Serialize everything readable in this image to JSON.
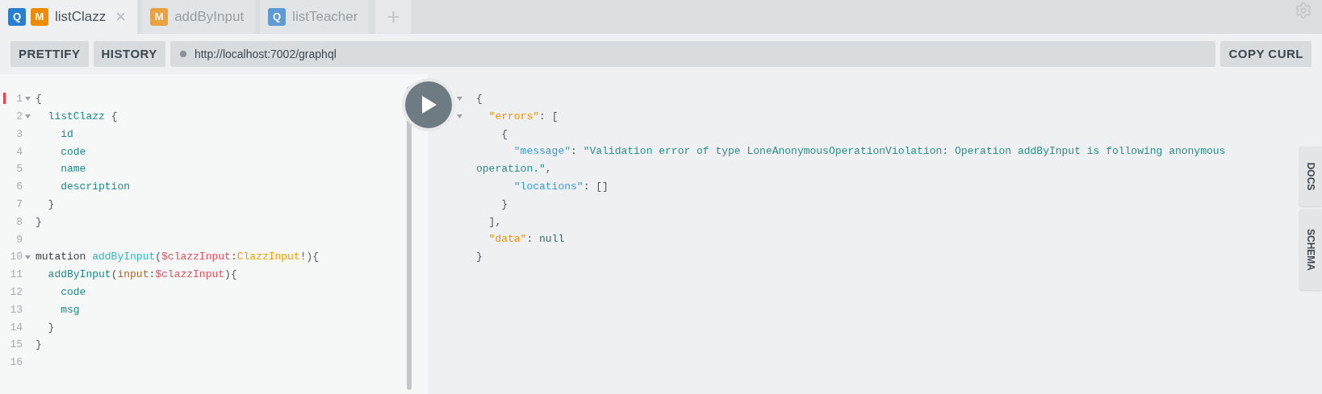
{
  "tabs": [
    {
      "badges": [
        {
          "kind": "query",
          "text": "Q"
        },
        {
          "kind": "mutation",
          "text": "M"
        }
      ],
      "label": "listClazz",
      "close": "×",
      "selected": true
    },
    {
      "badges": [
        {
          "kind": "mutation",
          "text": "M"
        }
      ],
      "label": "addByInput",
      "selected": false
    },
    {
      "badges": [
        {
          "kind": "query",
          "text": "Q"
        }
      ],
      "label": "listTeacher",
      "selected": false
    }
  ],
  "new_tab": "+",
  "toolbar": {
    "buttons": [
      "PRETTIFY",
      "HISTORY"
    ],
    "url": "http://localhost:7002/graphql",
    "copy": "COPY CURL"
  },
  "query_lines": [
    {
      "number": "1",
      "foldable": true,
      "marked": true,
      "tokens": [
        {
          "kind": "punct",
          "text": "{"
        }
      ]
    },
    {
      "number": "2",
      "foldable": true,
      "marked": false,
      "tokens": [
        {
          "kind": "field",
          "text": "  listClazz"
        },
        {
          "kind": "punct",
          "text": " {"
        }
      ]
    },
    {
      "number": "3",
      "foldable": false,
      "marked": false,
      "tokens": [
        {
          "kind": "field",
          "text": "    id"
        }
      ]
    },
    {
      "number": "4",
      "foldable": false,
      "marked": false,
      "tokens": [
        {
          "kind": "field",
          "text": "    code"
        }
      ]
    },
    {
      "number": "5",
      "foldable": false,
      "marked": false,
      "tokens": [
        {
          "kind": "field",
          "text": "    name"
        }
      ]
    },
    {
      "number": "6",
      "foldable": false,
      "marked": false,
      "tokens": [
        {
          "kind": "field",
          "text": "    description"
        }
      ]
    },
    {
      "number": "7",
      "foldable": false,
      "marked": false,
      "tokens": [
        {
          "kind": "punct",
          "text": "  }"
        }
      ]
    },
    {
      "number": "8",
      "foldable": false,
      "marked": false,
      "tokens": [
        {
          "kind": "punct",
          "text": "}"
        }
      ]
    },
    {
      "number": "9",
      "foldable": false,
      "marked": false
    },
    {
      "number": "10",
      "foldable": true,
      "marked": false,
      "tokens": [
        {
          "kind": "keyword",
          "text": "mutation "
        },
        {
          "kind": "def",
          "text": "addByInput"
        },
        {
          "kind": "punct",
          "text": "("
        },
        {
          "kind": "variable",
          "text": "$clazzInput"
        },
        {
          "kind": "punct",
          "text": ":"
        },
        {
          "kind": "type",
          "text": "ClazzInput"
        },
        {
          "kind": "punct",
          "text": "!){"
        }
      ]
    },
    {
      "number": "11",
      "foldable": false,
      "marked": false,
      "tokens": [
        {
          "kind": "field",
          "text": "  addByInput"
        },
        {
          "kind": "punct",
          "text": "("
        },
        {
          "kind": "arg",
          "text": "input"
        },
        {
          "kind": "punct",
          "text": ":"
        },
        {
          "kind": "variable",
          "text": "$clazzInput"
        },
        {
          "kind": "punct",
          "text": "){"
        }
      ]
    },
    {
      "number": "12",
      "foldable": false,
      "marked": false,
      "tokens": [
        {
          "kind": "field",
          "text": "    code"
        }
      ]
    },
    {
      "number": "13",
      "foldable": false,
      "marked": false,
      "tokens": [
        {
          "kind": "field",
          "text": "    msg"
        }
      ]
    },
    {
      "number": "14",
      "foldable": false,
      "marked": false,
      "tokens": [
        {
          "kind": "punct",
          "text": "  }"
        }
      ]
    },
    {
      "number": "15",
      "foldable": false,
      "marked": false,
      "tokens": [
        {
          "kind": "punct",
          "text": "}"
        }
      ]
    },
    {
      "number": "16",
      "foldable": false,
      "marked": false
    }
  ],
  "result_lines": [
    {
      "foldable": true,
      "tokens": [
        {
          "kind": "punct",
          "text": "{"
        }
      ]
    },
    {
      "foldable": true,
      "tokens": [
        {
          "kind": "rootkey",
          "text": "  \"errors\""
        },
        {
          "kind": "punct",
          "text": ": ["
        }
      ]
    },
    {
      "foldable": false,
      "tokens": [
        {
          "kind": "punct",
          "text": "    {"
        }
      ]
    },
    {
      "foldable": false,
      "tokens": [
        {
          "kind": "key",
          "text": "      \"message\""
        },
        {
          "kind": "punct",
          "text": ": "
        },
        {
          "kind": "string",
          "text": "\"Validation error of type LoneAnonymousOperationViolation: Operation addByInput is following anonymous operation.\""
        },
        {
          "kind": "punct",
          "text": ","
        }
      ]
    },
    {
      "foldable": false,
      "tokens": [
        {
          "kind": "key",
          "text": "      \"locations\""
        },
        {
          "kind": "punct",
          "text": ": []"
        }
      ]
    },
    {
      "foldable": false,
      "tokens": [
        {
          "kind": "punct",
          "text": "    }"
        }
      ]
    },
    {
      "foldable": false,
      "tokens": [
        {
          "kind": "punct",
          "text": "  ],"
        }
      ]
    },
    {
      "foldable": false,
      "tokens": [
        {
          "kind": "rootkey",
          "text": "  \"data\""
        },
        {
          "kind": "punct",
          "text": ": "
        },
        {
          "kind": "null",
          "text": "null"
        }
      ]
    },
    {
      "foldable": false,
      "tokens": [
        {
          "kind": "punct",
          "text": "}"
        }
      ]
    }
  ],
  "side_tabs": [
    "DOCS",
    "SCHEMA"
  ]
}
